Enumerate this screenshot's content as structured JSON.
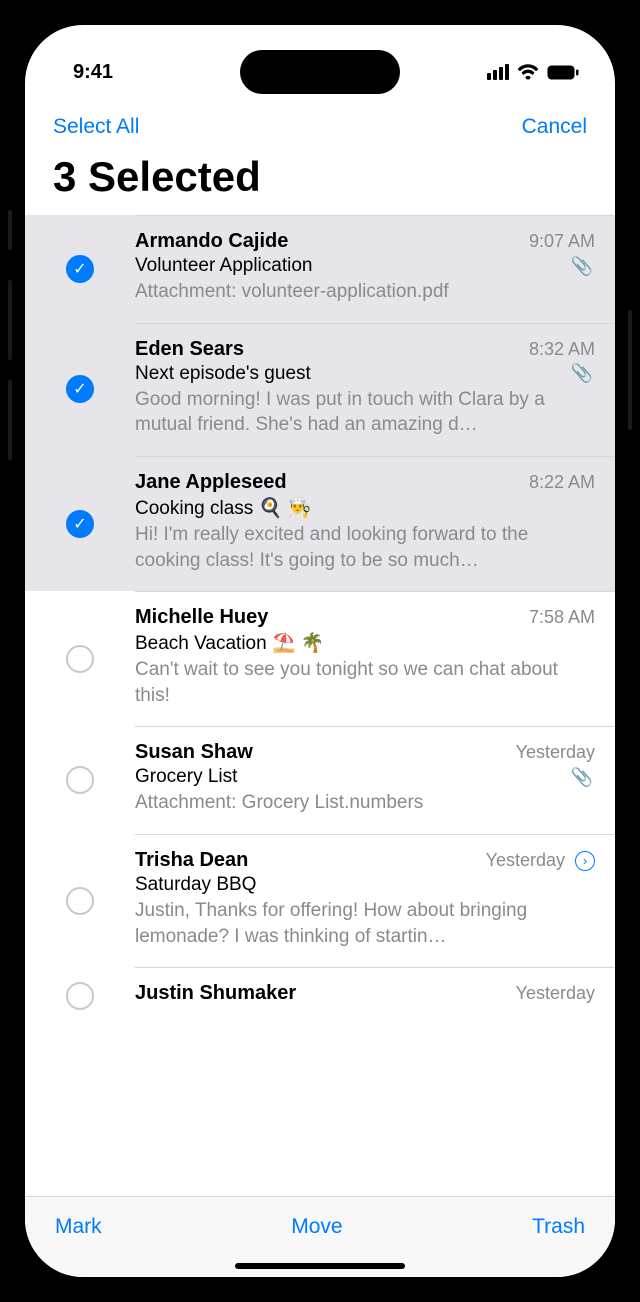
{
  "statusbar": {
    "time": "9:41"
  },
  "nav": {
    "left": "Select All",
    "right": "Cancel"
  },
  "title": "3 Selected",
  "emails": [
    {
      "selected": true,
      "sender": "Armando Cajide",
      "time": "9:07 AM",
      "subject": "Volunteer Application",
      "has_attachment": true,
      "preview": "Attachment: volunteer-application.pdf",
      "disclosure": false
    },
    {
      "selected": true,
      "sender": "Eden Sears",
      "time": "8:32 AM",
      "subject": "Next episode's guest",
      "has_attachment": true,
      "preview": "Good morning! I was put in touch with Clara by a mutual friend. She's had an amazing d…",
      "disclosure": false
    },
    {
      "selected": true,
      "sender": "Jane Appleseed",
      "time": "8:22 AM",
      "subject": "Cooking class 🍳 👨‍🍳",
      "has_attachment": false,
      "preview": "Hi! I'm really excited and looking forward to the cooking class! It's going to be so much…",
      "disclosure": false
    },
    {
      "selected": false,
      "sender": "Michelle Huey",
      "time": "7:58 AM",
      "subject": "Beach Vacation ⛱️ 🌴",
      "has_attachment": false,
      "preview": "Can't wait to see you tonight so we can chat about this!",
      "disclosure": false
    },
    {
      "selected": false,
      "sender": "Susan Shaw",
      "time": "Yesterday",
      "subject": "Grocery List",
      "has_attachment": true,
      "preview": "Attachment: Grocery List.numbers",
      "disclosure": false
    },
    {
      "selected": false,
      "sender": "Trisha Dean",
      "time": "Yesterday",
      "subject": "Saturday BBQ",
      "has_attachment": false,
      "preview": "Justin, Thanks for offering! How about bringing lemonade? I was thinking of startin…",
      "disclosure": true
    },
    {
      "selected": false,
      "sender": "Justin Shumaker",
      "time": "Yesterday",
      "subject": "",
      "has_attachment": false,
      "preview": "",
      "disclosure": false
    }
  ],
  "toolbar": {
    "mark": "Mark",
    "move": "Move",
    "trash": "Trash"
  }
}
